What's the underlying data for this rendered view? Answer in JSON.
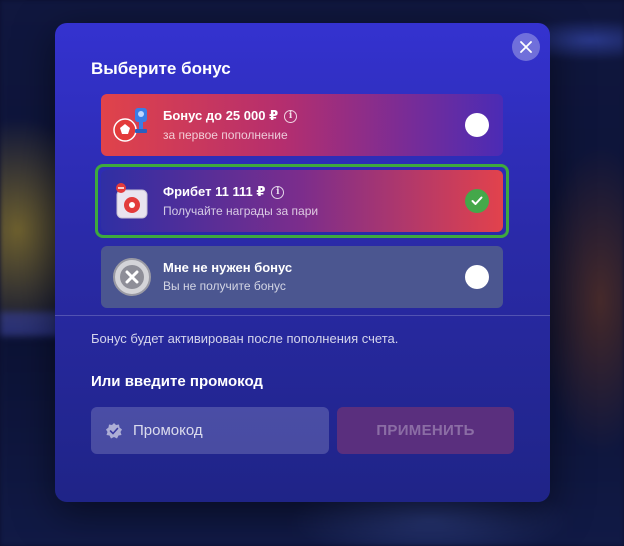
{
  "modal": {
    "title": "Выберите бонус",
    "close_icon": "close-icon"
  },
  "options": [
    {
      "title": "Бонус до 25 000 ₽",
      "subtitle": "за первое пополнение",
      "icon": "football-trophy-icon",
      "selected": false,
      "has_info": true
    },
    {
      "title": "Фрибет 11 111 ₽",
      "subtitle": "Получайте награды за пари",
      "icon": "gift-box-icon",
      "selected": true,
      "has_info": true
    },
    {
      "title": "Мне не нужен бонус",
      "subtitle": "Вы не получите бонус",
      "icon": "no-bonus-icon",
      "selected": false,
      "has_info": false
    }
  ],
  "note": "Бонус будет активирован после пополнения счета.",
  "promo": {
    "title": "Или введите промокод",
    "placeholder": "Промокод",
    "value": "",
    "apply_label": "ПРИМЕНИТЬ"
  },
  "colors": {
    "selected_border": "#3ea93e",
    "check": "#44a84a",
    "modal_top": "#3432d0",
    "apply_bg": "#5a2f7e"
  }
}
